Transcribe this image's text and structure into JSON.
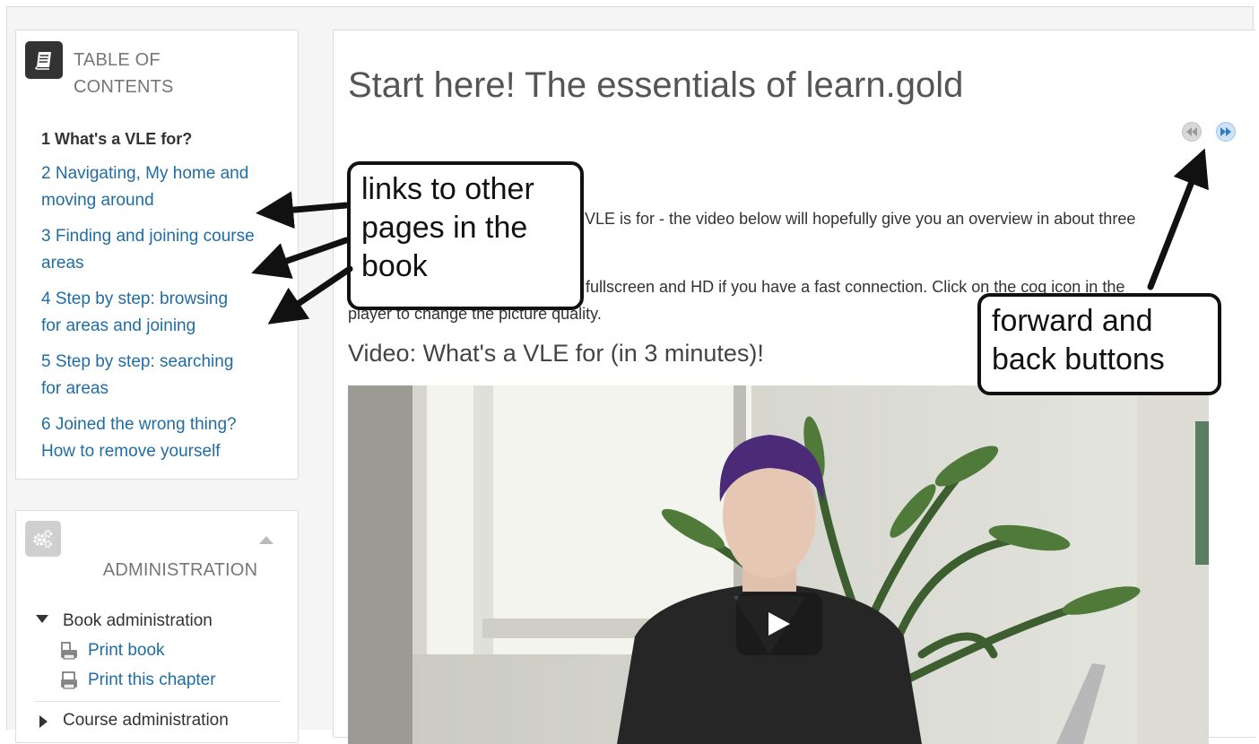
{
  "toc": {
    "title_line1": "TABLE OF",
    "title_line2": "CONTENTS",
    "icon": "book-icon",
    "items": [
      {
        "label": "1 What's a VLE for?",
        "current": true
      },
      {
        "label_line1": "2 Navigating, My home and",
        "label_line2": "moving around"
      },
      {
        "label_line1": "3 Finding and joining course",
        "label_line2": "areas"
      },
      {
        "label_line1": "4 Step by step: browsing",
        "label_line2": "for areas and joining"
      },
      {
        "label_line1": "5 Step by step: searching",
        "label_line2": "for areas"
      },
      {
        "label_line1": "6 Joined the wrong thing?",
        "label_line2": "How to remove yourself"
      }
    ]
  },
  "admin": {
    "title": "ADMINISTRATION",
    "icon": "gears-icon",
    "book_admin": "Book administration",
    "print_book": "Print book",
    "print_chapter": "Print this chapter",
    "course_admin": "Course administration"
  },
  "main": {
    "title": "Start here! The essentials of learn.gold",
    "para1": "VLE is for - the video below will hopefully give you an overview in about three",
    "para2": "fullscreen and HD if you have a fast connection. Click on the cog icon in the",
    "para3": "player to change the picture quality.",
    "video_heading": "Video: What's a VLE for (in 3 minutes)!",
    "nav_back_icon": "rewind-icon",
    "nav_forward_icon": "fast-forward-icon",
    "play_icon": "play-icon"
  },
  "annotations": {
    "links_line1": "links to other",
    "links_line2": "pages in the",
    "links_line3": "book",
    "nav_line1": "forward and",
    "nav_line2": "back buttons"
  }
}
